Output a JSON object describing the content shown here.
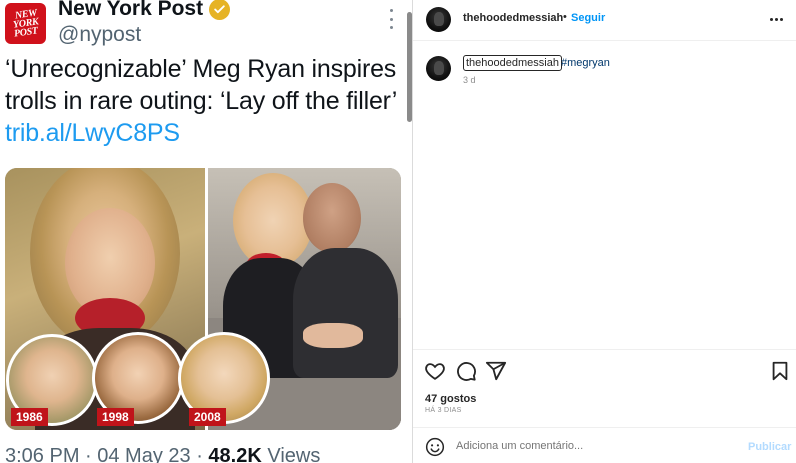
{
  "tweet": {
    "logo_lines": [
      "NEW",
      "YORK",
      "POST"
    ],
    "name": "New York Post",
    "handle": "@nypost",
    "text": "‘Unrecognizable’ Meg Ryan inspires trolls in rare outing: ‘Lay off the filler’ ",
    "link": "trib.al/LwyC8PS",
    "photo_years": [
      "1986",
      "1998",
      "2008"
    ],
    "footer_time": "3:06 PM · 04 May 23 · ",
    "footer_views_count": "48.2K",
    "footer_views_label": " Views"
  },
  "instagram": {
    "header": {
      "username": "thehoodedmessiah",
      "separator": "•",
      "follow_label": "Seguir"
    },
    "caption": {
      "username": "thehoodedmessiah",
      "hashtag": "#megryan",
      "time": "3 d"
    },
    "actions": {
      "icons": [
        "heart-icon",
        "comment-icon",
        "share-icon",
        "bookmark-icon"
      ]
    },
    "likes": "47 gostos",
    "posted_ago": "HÁ 3 DIAS",
    "comment_input": {
      "placeholder": "Adiciona um comentário...",
      "post_label": "Publicar"
    }
  }
}
